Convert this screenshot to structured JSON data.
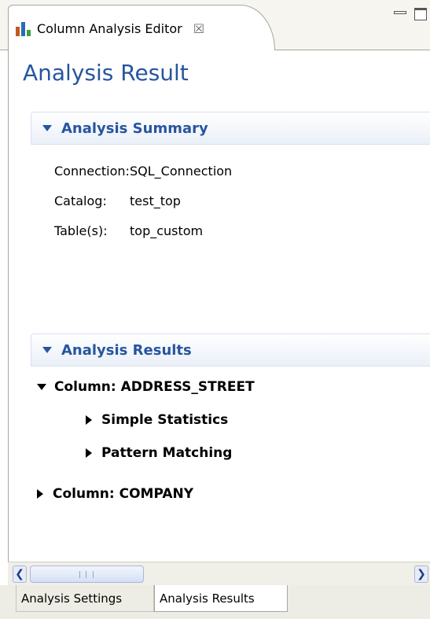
{
  "editor_tab": {
    "label": "Column Analysis Editor",
    "close_icon": "close-icon"
  },
  "page_title": "Analysis Result",
  "summary": {
    "title": "Analysis Summary",
    "rows": [
      {
        "key": "Connection:",
        "value": "SQL_Connection"
      },
      {
        "key": "Catalog:",
        "value": "test_top"
      },
      {
        "key": "Table(s):",
        "value": "top_custom"
      }
    ]
  },
  "results": {
    "title": "Analysis Results",
    "columns": [
      {
        "label": "Column: ADDRESS_STREET",
        "expanded": true,
        "children": [
          "Simple Statistics",
          "Pattern Matching"
        ]
      },
      {
        "label": "Column: COMPANY",
        "expanded": false
      }
    ]
  },
  "bottom_tabs": [
    "Analysis Settings",
    "Analysis Results"
  ],
  "scrollbar": {
    "grip": "III"
  },
  "colors": {
    "title_blue": "#27559f",
    "header_bg": "#eaf0f8"
  }
}
